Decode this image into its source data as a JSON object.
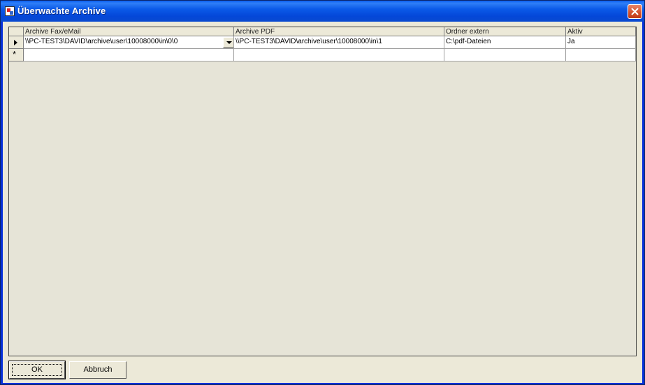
{
  "window": {
    "title": "Überwachte Archive"
  },
  "grid": {
    "columns": [
      "Archive Fax/eMail",
      "Archive PDF",
      "Ordner extern",
      "Aktiv"
    ],
    "rows": [
      [
        "\\\\PC-TEST3\\DAVID\\archive\\user\\10008000\\in\\0\\0",
        "\\\\PC-TEST3\\DAVID\\archive\\user\\10008000\\in\\1",
        "C:\\pdf-Dateien",
        "Ja"
      ]
    ],
    "new_row_marker": "*"
  },
  "buttons": {
    "ok": "OK",
    "cancel": "Abbruch"
  },
  "icons": {
    "app": "app-icon",
    "close": "close-icon",
    "current_row": "row-pointer-icon",
    "dropdown": "chevron-down-icon"
  },
  "colors": {
    "titlebar": "#0a5ff2",
    "close": "#d4532f",
    "client": "#ece9d8"
  }
}
